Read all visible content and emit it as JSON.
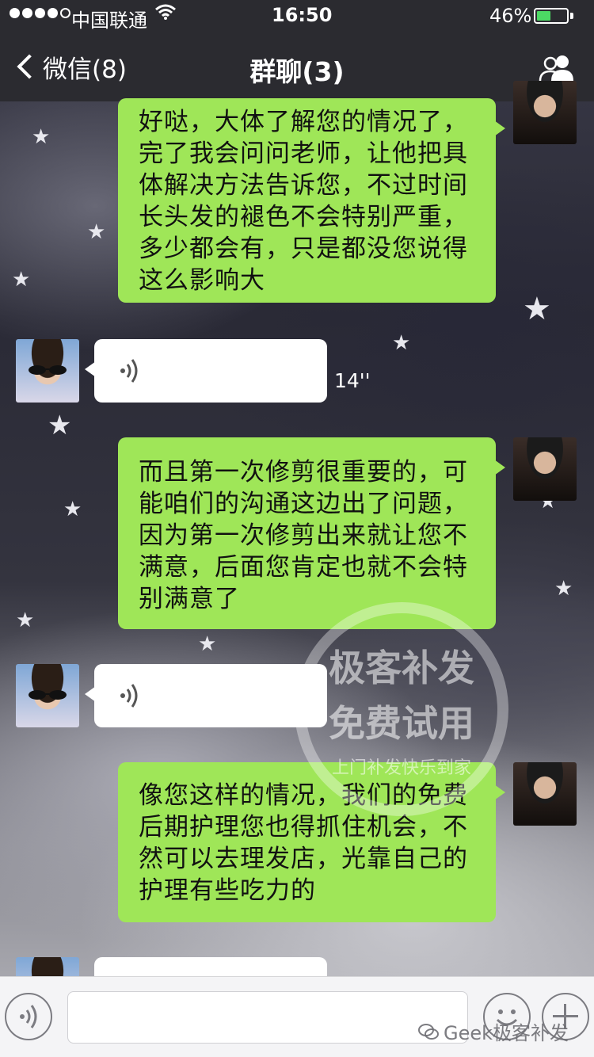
{
  "status_bar": {
    "carrier": "中国联通",
    "time": "16:50",
    "battery_percent_label": "46%",
    "battery_level": 0.46
  },
  "nav": {
    "back_label": "微信(8)",
    "title": "群聊(3)",
    "right_icon": "group-members-icon"
  },
  "messages": [
    {
      "side": "out",
      "type": "text",
      "text": "好哒，大体了解您的情况了，完了我会问问老师，让他把具体解决方法告诉您，不过时间长头发的褪色不会特别严重，多少都会有，只是都没您说得这么影响大"
    },
    {
      "side": "in",
      "type": "voice",
      "duration": "14''"
    },
    {
      "side": "out",
      "type": "text",
      "text": "而且第一次修剪很重要的，可能咱们的沟通这边出了问题，因为第一次修剪出来就让您不满意，后面您肯定也就不会特别满意了"
    },
    {
      "side": "in",
      "type": "voice",
      "duration": ""
    },
    {
      "side": "out",
      "type": "text",
      "text": "像您这样的情况，我们的免费后期护理您也得抓住机会，不然可以去理发店，光靠自己的护理有些吃力的"
    },
    {
      "side": "in",
      "type": "voice",
      "duration": ""
    }
  ],
  "watermark": {
    "line1": "极客补发",
    "line2": "免费试用",
    "line3": "上门补发快乐到家"
  },
  "input_bar": {
    "voice_toggle_icon": "voice-icon",
    "emoji_icon": "emoji-icon",
    "plus_icon": "plus-icon"
  },
  "credit": "Geek极客补发",
  "colors": {
    "nav_bg": "#2b2b30",
    "outgoing_bubble": "#9fe658",
    "incoming_bubble": "#ffffff",
    "battery": "#4cd964"
  }
}
